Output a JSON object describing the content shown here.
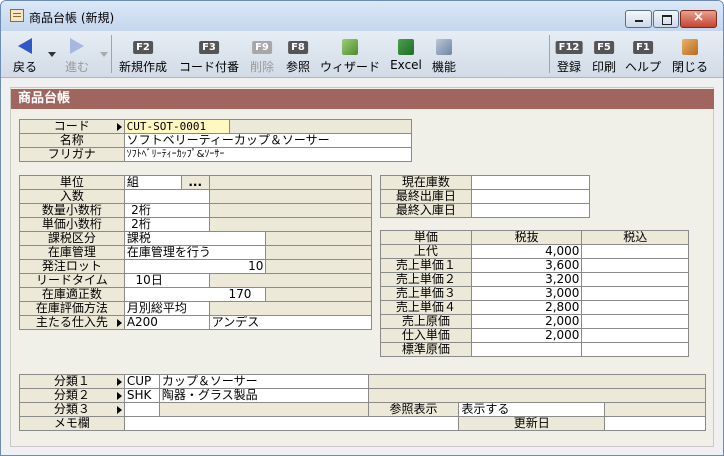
{
  "window": {
    "title": "商品台帳 (新規)"
  },
  "toolbar": {
    "back": "戻る",
    "forward": "進む",
    "f2_key": "F2",
    "f2_label": "新規作成",
    "f3_key": "F3",
    "f3_label": "コード付番",
    "f9_key": "F9",
    "f9_label": "削除",
    "f8_key": "F8",
    "f8_label": "参照",
    "wizard_label": "ウィザード",
    "excel_label": "Excel",
    "func_label": "機能",
    "f12_key": "F12",
    "f12_label": "登録",
    "f5_key": "F5",
    "f5_label": "印刷",
    "f1_key": "F1",
    "f1_label": "ヘルプ",
    "close_label": "閉じる"
  },
  "section_title": "商品台帳",
  "basic": {
    "code_label": "コード",
    "code_value": "CUT-SOT-0001",
    "name_label": "名称",
    "name_value": "ソフトベリーティーカップ＆ソーサー",
    "kana_label": "フリガナ",
    "kana_value": "ｿﾌﾄﾍﾞﾘｰﾃｨｰｶｯﾌﾟ&ｿｰｻｰ"
  },
  "detail": {
    "unit_label": "単位",
    "unit_value": "組",
    "unit_button": "...",
    "qty_label": "入数",
    "qty_value": "",
    "qty_dec_label": "数量小数桁",
    "qty_dec_value": "2",
    "qty_dec_unit": "桁",
    "price_dec_label": "単価小数桁",
    "price_dec_value": "2",
    "price_dec_unit": "桁",
    "tax_label": "課税区分",
    "tax_value": "課税",
    "stock_label": "在庫管理",
    "stock_value": "在庫管理を行う",
    "lot_label": "発注ロット",
    "lot_value": "10",
    "lead_label": "リードタイム",
    "lead_value": "10",
    "lead_unit": "日",
    "proper_label": "在庫適正数",
    "proper_value": "170",
    "eval_label": "在庫評価方法",
    "eval_value": "月別総平均",
    "supplier_label": "主たる仕入先",
    "supplier_code": "A200",
    "supplier_name": "アンデス"
  },
  "stock_info": {
    "current_label": "現在庫数",
    "current_value": "",
    "last_out_label": "最終出庫日",
    "last_out_value": "",
    "last_in_label": "最終入庫日",
    "last_in_value": ""
  },
  "prices": {
    "headers": [
      "単価",
      "税抜",
      "税込"
    ],
    "rows": [
      {
        "label": "上代",
        "excl": "4,000",
        "incl": ""
      },
      {
        "label": "売上単価１",
        "excl": "3,600",
        "incl": ""
      },
      {
        "label": "売上単価２",
        "excl": "3,200",
        "incl": ""
      },
      {
        "label": "売上単価３",
        "excl": "3,000",
        "incl": ""
      },
      {
        "label": "売上単価４",
        "excl": "2,800",
        "incl": ""
      },
      {
        "label": "売上原価",
        "excl": "2,000",
        "incl": ""
      },
      {
        "label": "仕入単価",
        "excl": "2,000",
        "incl": ""
      },
      {
        "label": "標準原価",
        "excl": "",
        "incl": ""
      }
    ]
  },
  "classify": {
    "c1_label": "分類１",
    "c1_code": "CUP",
    "c1_name": "カップ＆ソーサー",
    "c2_label": "分類２",
    "c2_code": "SHK",
    "c2_name": "陶器・グラス製品",
    "c3_label": "分類３",
    "c3_code": "",
    "c3_name": "",
    "ref_label": "参照表示",
    "ref_value": "表示する",
    "memo_label": "メモ欄",
    "memo_value": "",
    "updated_label": "更新日",
    "updated_value": ""
  },
  "colors": {
    "accent": "#a0655f",
    "highlight": "#fff8c0",
    "label_bg": "#ece9d8"
  }
}
